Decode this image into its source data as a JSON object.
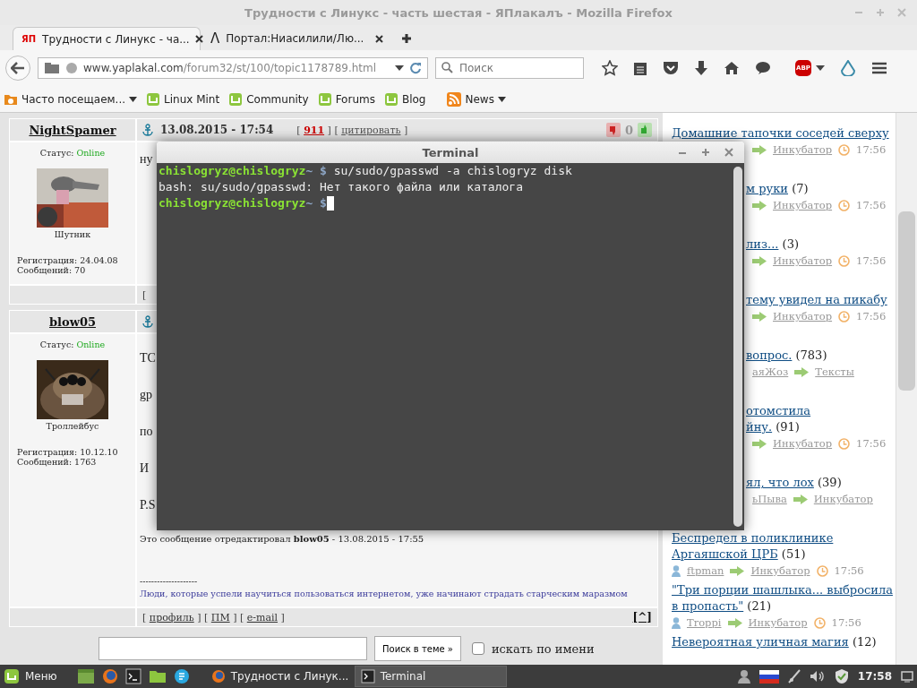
{
  "browser": {
    "title": "Трудности с Линукс - часть шестая - ЯПлакалъ - Mozilla Firefox",
    "tabs": [
      {
        "favicon": "ЯП",
        "label": "Трудности с Линукс - ча...",
        "selected": true
      },
      {
        "favicon": "Λ",
        "label": "Портал:Ниасилили/Лю...",
        "selected": false
      }
    ],
    "url": {
      "domain": "www.yaplakal.com",
      "path": "/forum32/st/100/topic1178789.html"
    },
    "search": {
      "placeholder": "Поиск"
    },
    "abp": "ABP",
    "bookmarks": [
      {
        "kind": "folder",
        "label": "Часто посещаем...",
        "menu": true
      },
      {
        "kind": "mint",
        "label": "Linux Mint",
        "menu": false
      },
      {
        "kind": "mint",
        "label": "Community",
        "menu": false
      },
      {
        "kind": "mint",
        "label": "Forums",
        "menu": false
      },
      {
        "kind": "mint",
        "label": "Blog",
        "menu": false
      },
      {
        "kind": "rss",
        "label": "News",
        "menu": true
      }
    ]
  },
  "posts": [
    {
      "author": "NightSpamer",
      "status_label": "Статус:",
      "status": "Online",
      "rank": "Шутник",
      "registered": "Регистрация: 24.04.08",
      "messages": "Сообщений: 70",
      "date": "13.08.2015 - 17:54",
      "open": "[",
      "close": "]",
      "number": "911",
      "quote": "цитировать",
      "rating": "0",
      "body": [
        "ну"
      ],
      "footer": "["
    },
    {
      "author": "blow05",
      "status_label": "Статус:",
      "status": "Online",
      "rank": "Троллейбус",
      "registered": "Регистрация: 10.12.10",
      "messages": "Сообщений: 1763",
      "body": [
        "ТС",
        "gp",
        "по",
        "И",
        "P.S"
      ],
      "edited": "Это сообщение отредактировал **blow05** - 13.08.2015 - 17:55",
      "signature": [
        "--------------------",
        "Люди, которые успели научиться пользоваться интернетом, уже начинают страдать старческим маразмом"
      ],
      "open": "[",
      "close": "]",
      "links": [
        "профиль",
        "ПМ",
        "e-mail"
      ],
      "top": "[^]"
    }
  ],
  "topic_search": {
    "button": "Поиск в теме »",
    "by_name": "искать по имени",
    "checked": false
  },
  "sidebar": [
    {
      "title": [
        "Домашние тапочки соседей сверху"
      ],
      "section": "Инкубатор",
      "time": "17:56"
    },
    {
      "title": [
        "м руки"
      ],
      "count": "(7)",
      "section": "Инкубатор",
      "time": "17:56"
    },
    {
      "title": [
        "лиз..."
      ],
      "count": "(3)",
      "section": "Инкубатор",
      "time": "17:56"
    },
    {
      "title": [
        "тему увидел на пикабу"
      ],
      "section": "Инкубатор",
      "time": "17:56"
    },
    {
      "title": [
        "вопрос."
      ],
      "count": "(783)",
      "author": "аяЖоз",
      "section": "Тексты"
    },
    {
      "title": [
        "отомстила",
        "йну."
      ],
      "count": "(91)",
      "section": "Инкубатор",
      "time": "17:56"
    },
    {
      "title": [
        "ял, что лох"
      ],
      "count": "(39)",
      "author": "ьПыва",
      "section": "Инкубатор"
    },
    {
      "title": [
        "Беспредел в поликлинике",
        "Аргаяшской ЦРБ"
      ],
      "count": "(51)",
      "author": "ftpman",
      "section": "Инкубатор",
      "time": "17:56"
    },
    {
      "title": [
        "\"Три порции шашлыка... выбросила",
        "в пропасть\""
      ],
      "count": "(21)",
      "author": "Troppi",
      "section": "Инкубатор",
      "time": "17:56"
    },
    {
      "title": [
        "Невероятная уличная магия"
      ],
      "count": "(12)"
    }
  ],
  "terminal": {
    "title": "Terminal",
    "lines": [
      {
        "kind": "prompt",
        "user": "chislogryz@chislogryz",
        "path": "~",
        "sign": "$",
        "command": "su/sudo/gpasswd -a chislogryz disk",
        "cursor": false
      },
      {
        "kind": "output",
        "text": "bash: su/sudo/gpasswd: Нет такого файла или каталога"
      },
      {
        "kind": "prompt",
        "user": "chislogryz@chislogryz",
        "path": "~",
        "sign": "$",
        "cursor": true
      }
    ]
  },
  "taskbar": {
    "menu": "Меню",
    "windows": [
      {
        "kind": "firefox",
        "label": "Трудности с Линук...",
        "selected": false
      },
      {
        "kind": "terminal",
        "label": "Terminal",
        "selected": true
      }
    ],
    "clock": "17:58"
  }
}
